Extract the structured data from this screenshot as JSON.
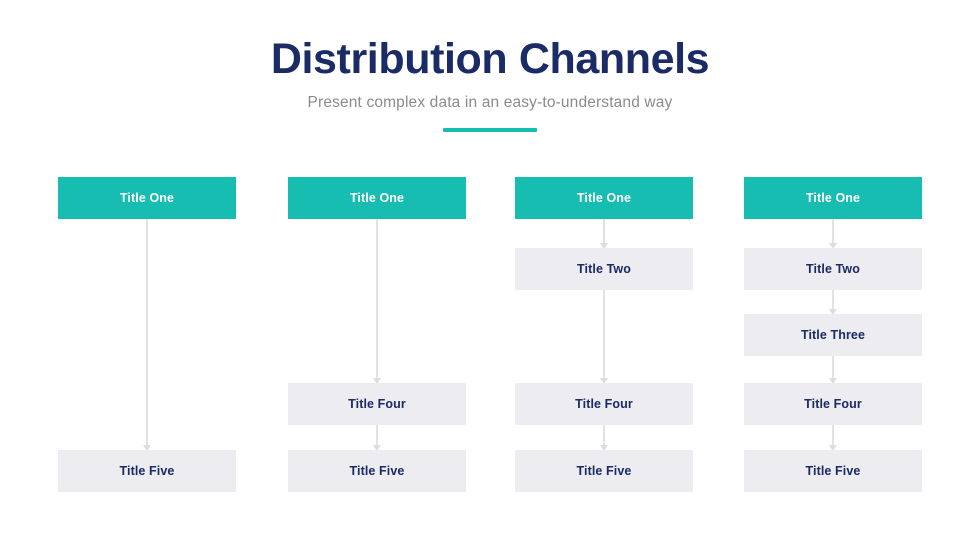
{
  "header": {
    "title": "Distribution Channels",
    "subtitle": "Present complex data in an easy-to-understand way"
  },
  "theme": {
    "background": "#ffffff",
    "primary_fill": "#16bdb0",
    "primary_text": "#ffffff",
    "secondary_fill": "#edecf0",
    "secondary_text": "#1a2b66",
    "title_color": "#1a2b66",
    "subtitle_color": "#8b8b8f",
    "connector_color": "#e2e2e6",
    "rule_color": "#16bdb0"
  },
  "chart_data": {
    "type": "diagram",
    "title": "Distribution Channels",
    "subtitle": "Present complex data in an easy-to-understand way",
    "description": "Four parallel vertical flow chains of stacked labelled blocks, each starting with a highlighted teal block and connected downward by thin arrows.",
    "row_labels": [
      "Title One",
      "Title Two",
      "Title Three",
      "Title Four",
      "Title Five"
    ],
    "columns": [
      {
        "index": 1,
        "node_count": 2,
        "nodes": [
          {
            "row": 0,
            "label": "Title One",
            "style": "primary"
          },
          {
            "row": 4,
            "label": "Title Five",
            "style": "secondary"
          }
        ],
        "connectors": [
          {
            "from_row": 0,
            "to_row": 4
          }
        ]
      },
      {
        "index": 2,
        "node_count": 3,
        "nodes": [
          {
            "row": 0,
            "label": "Title One",
            "style": "primary"
          },
          {
            "row": 3,
            "label": "Title Four",
            "style": "secondary"
          },
          {
            "row": 4,
            "label": "Title Five",
            "style": "secondary"
          }
        ],
        "connectors": [
          {
            "from_row": 0,
            "to_row": 3
          },
          {
            "from_row": 3,
            "to_row": 4
          }
        ]
      },
      {
        "index": 3,
        "node_count": 4,
        "nodes": [
          {
            "row": 0,
            "label": "Title One",
            "style": "primary"
          },
          {
            "row": 1,
            "label": "Title Two",
            "style": "secondary"
          },
          {
            "row": 3,
            "label": "Title Four",
            "style": "secondary"
          },
          {
            "row": 4,
            "label": "Title Five",
            "style": "secondary"
          }
        ],
        "connectors": [
          {
            "from_row": 0,
            "to_row": 1
          },
          {
            "from_row": 1,
            "to_row": 3
          },
          {
            "from_row": 3,
            "to_row": 4
          }
        ]
      },
      {
        "index": 4,
        "node_count": 5,
        "nodes": [
          {
            "row": 0,
            "label": "Title One",
            "style": "primary"
          },
          {
            "row": 1,
            "label": "Title Two",
            "style": "secondary"
          },
          {
            "row": 2,
            "label": "Title Three",
            "style": "secondary"
          },
          {
            "row": 3,
            "label": "Title Four",
            "style": "secondary"
          },
          {
            "row": 4,
            "label": "Title Five",
            "style": "secondary"
          }
        ],
        "connectors": [
          {
            "from_row": 0,
            "to_row": 1
          },
          {
            "from_row": 1,
            "to_row": 2
          },
          {
            "from_row": 2,
            "to_row": 3
          },
          {
            "from_row": 3,
            "to_row": 4
          }
        ]
      }
    ]
  }
}
